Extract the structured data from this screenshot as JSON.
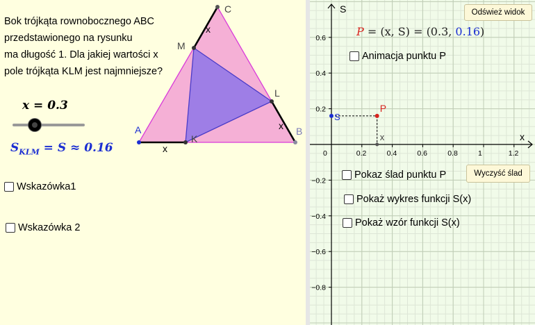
{
  "problem": {
    "lines": [
      "Bok trójkąta rownobocznego ABC",
      "przedstawionego na rysunku",
      "ma długość 1. Dla jakiej wartości x",
      "pole trójkąta KLM jest najmniejsze?"
    ]
  },
  "slider": {
    "label": "x = 0.3",
    "value": 0.3,
    "min": 0,
    "max": 1
  },
  "area_formula": "S_KLM = S ≈ 0.16",
  "area_formula_parts": {
    "main": "S",
    "sub": "KLM",
    "rest": " = S ≈ 0.16"
  },
  "checkboxes_left": [
    "Wskazówka1",
    "Wskazówka 2"
  ],
  "triangle": {
    "vertex_labels": {
      "A": "A",
      "B": "B",
      "C": "C",
      "K": "K",
      "L": "L",
      "M": "M"
    },
    "segment_label": "x",
    "colors": {
      "outer_fill": "#f5b0d6",
      "outer_stroke": "#d93bd9",
      "inner_fill": "#9e7ee6",
      "inner_stroke": "#4a3cc8",
      "side": "#000000",
      "label_blue": "#1b2ed2"
    }
  },
  "graph": {
    "buttons": {
      "refresh": "Odśwież widok",
      "clear_trace": "Wyczyść ślad"
    },
    "point_formula": {
      "lhs": "P",
      "mid": " = (x, S) = (0.3, ",
      "value": "0.16",
      "end": ")"
    },
    "checkboxes": {
      "animate": "Animacja punktu P",
      "trace": "Pokaz ślad punktu P",
      "plot": "Pokaż wykres funkcji S(x)",
      "formula": "Pokaż wzór funkcji S(x)"
    },
    "axis_labels": {
      "x": "x",
      "y": "S"
    },
    "x_ticks": [
      "0",
      "0.2",
      "0.4",
      "0.6",
      "0.8",
      "1",
      "1.2"
    ],
    "y_ticks": [
      "0.6",
      "0.4",
      "0.2",
      "−0.2",
      "−0.4",
      "−0.6",
      "−0.8"
    ],
    "point": {
      "label": "P",
      "x": 0.3,
      "y": 0.16,
      "color": "#d8241f"
    },
    "proj_labels": {
      "s": "S",
      "x": "x"
    }
  }
}
